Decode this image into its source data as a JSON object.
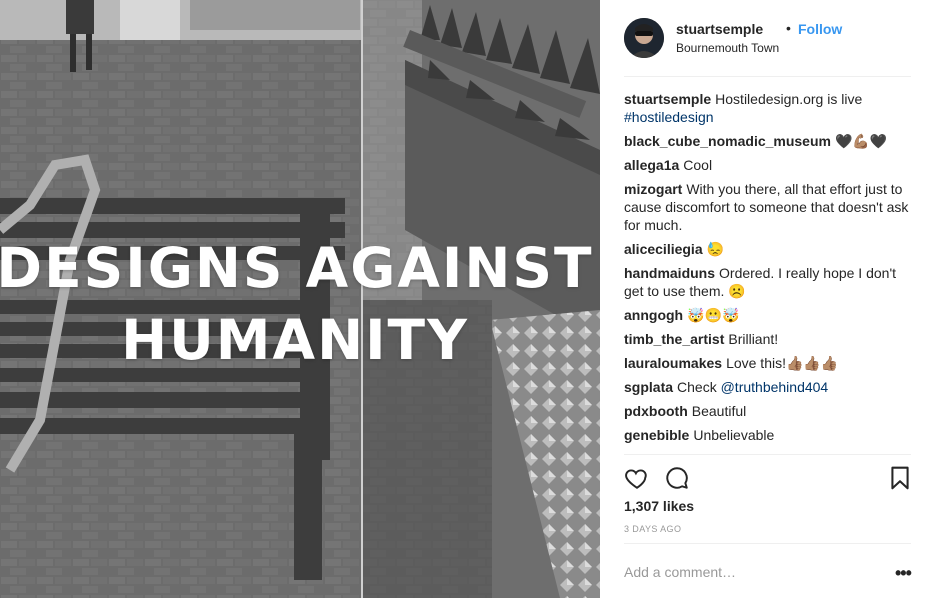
{
  "post": {
    "headline_line1": "DESIGNS AGAINST",
    "headline_line2": "HUMANITY"
  },
  "header": {
    "username": "stuartsemple",
    "separator": "•",
    "follow_label": "Follow",
    "location": "Bournemouth Town"
  },
  "comments": [
    {
      "user": "stuartsemple",
      "text": "Hostiledesign.org is live",
      "hashtag": "#hostiledesign"
    },
    {
      "user": "black_cube_nomadic_museum",
      "text": "🖤💪🏽🖤"
    },
    {
      "user": "allega1a",
      "text": "Cool"
    },
    {
      "user": "mizogart",
      "text": "With you there, all that effort just to cause discomfort to someone that doesn't ask for much."
    },
    {
      "user": "aliceciliegia",
      "text": "😓"
    },
    {
      "user": "handmaiduns",
      "text": "Ordered. I really hope I don't get to use them. ☹️"
    },
    {
      "user": "anngogh",
      "text": "🤯😬🤯"
    },
    {
      "user": "timb_the_artist",
      "text": "Brilliant!"
    },
    {
      "user": "lauraloumakes",
      "text": "Love this!👍🏽👍🏽👍🏽"
    },
    {
      "user": "sgplata",
      "text": "Check",
      "mention": "@truthbehind404"
    },
    {
      "user": "pdxbooth",
      "text": "Beautiful"
    },
    {
      "user": "genebible",
      "text": "Unbelievable"
    }
  ],
  "actions": {
    "like_icon": "heart-icon",
    "comment_icon": "comment-icon",
    "save_icon": "bookmark-icon"
  },
  "likes": "1,307 likes",
  "timestamp": "3 DAYS AGO",
  "add_comment_placeholder": "Add a comment…",
  "more_label": "•••",
  "colors": {
    "follow": "#3897f0",
    "hashtag": "#003569",
    "muted": "#999999",
    "divider": "#efefef"
  }
}
